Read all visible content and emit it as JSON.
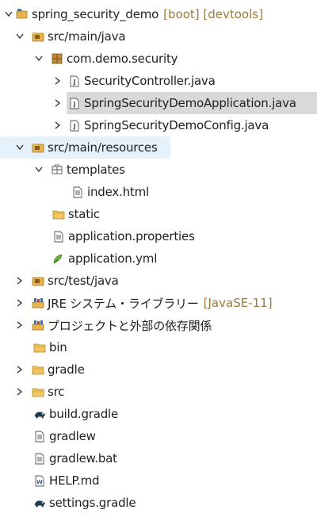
{
  "tree": {
    "project": {
      "name": "spring_security_demo",
      "decoration": "[boot] [devtools]",
      "icon": "project-icon"
    },
    "src_main_java": {
      "label": "src/main/java",
      "icon": "source-folder-icon"
    },
    "package": {
      "label": "com.demo.security",
      "icon": "package-icon"
    },
    "files_java": [
      {
        "label": "SecurityController.java",
        "icon": "java-file-icon"
      },
      {
        "label": "SpringSecurityDemoApplication.java",
        "icon": "java-file-icon",
        "selected": true
      },
      {
        "label": "SpringSecurityDemoConfig.java",
        "icon": "java-file-icon"
      }
    ],
    "src_main_resources": {
      "label": "src/main/resources",
      "icon": "source-folder-icon",
      "selected": true
    },
    "templates": {
      "label": "templates",
      "icon": "templates-folder-icon"
    },
    "index_html": {
      "label": "index.html",
      "icon": "html-file-icon"
    },
    "static": {
      "label": "static",
      "icon": "folder-icon"
    },
    "app_properties": {
      "label": "application.properties",
      "icon": "properties-file-icon"
    },
    "app_yml": {
      "label": "application.yml",
      "icon": "yml-file-icon"
    },
    "src_test_java": {
      "label": "src/test/java",
      "icon": "source-folder-icon"
    },
    "jre": {
      "label": "JRE システム・ライブラリー",
      "decoration": "[JavaSE-11]",
      "icon": "library-icon"
    },
    "deps": {
      "label": "プロジェクトと外部の依存関係",
      "icon": "library-icon"
    },
    "bin": {
      "label": "bin",
      "icon": "folder-icon"
    },
    "gradle": {
      "label": "gradle",
      "icon": "folder-icon"
    },
    "src": {
      "label": "src",
      "icon": "folder-icon"
    },
    "build_gradle": {
      "label": "build.gradle",
      "icon": "gradle-file-icon"
    },
    "gradlew": {
      "label": "gradlew",
      "icon": "text-file-icon"
    },
    "gradlew_bat": {
      "label": "gradlew.bat",
      "icon": "text-file-icon"
    },
    "help_md": {
      "label": "HELP.md",
      "icon": "markdown-file-icon"
    },
    "settings_gradle": {
      "label": "settings.gradle",
      "icon": "gradle-file-icon"
    }
  },
  "colors": {
    "decoration": "#9a7a3a",
    "selection_gray": "#d9d9d9",
    "selection_blue": "#e5f1fb",
    "folder": "#e8b34a",
    "package": "#a06a2c",
    "java": "#4a4a4a",
    "gradle": "#1f3a4a"
  }
}
